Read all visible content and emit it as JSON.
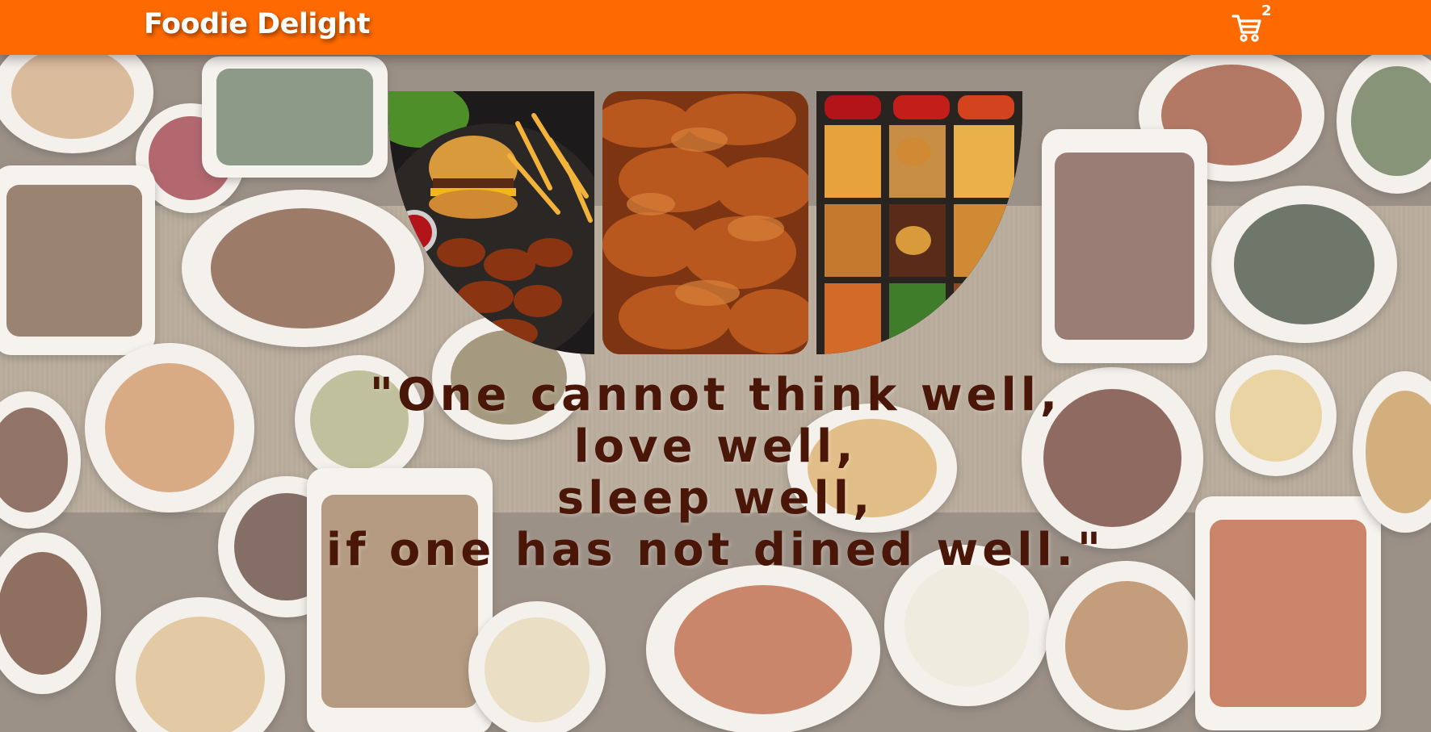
{
  "header": {
    "brand": "Foodie Delight",
    "cart_icon": "cart-icon",
    "cart_count": "2"
  },
  "colors": {
    "header_bg": "#ff6a00",
    "brand_text": "#ffffff",
    "quote_text": "#4a1608"
  },
  "gallery": [
    {
      "subject": "burger-fries-wings-platter"
    },
    {
      "subject": "fried-chicken-wings"
    },
    {
      "subject": "street-food-platter"
    }
  ],
  "quote": {
    "lines": [
      "\"One cannot think well,",
      "love well,",
      "sleep well,",
      "if one has not dined well.\""
    ]
  }
}
